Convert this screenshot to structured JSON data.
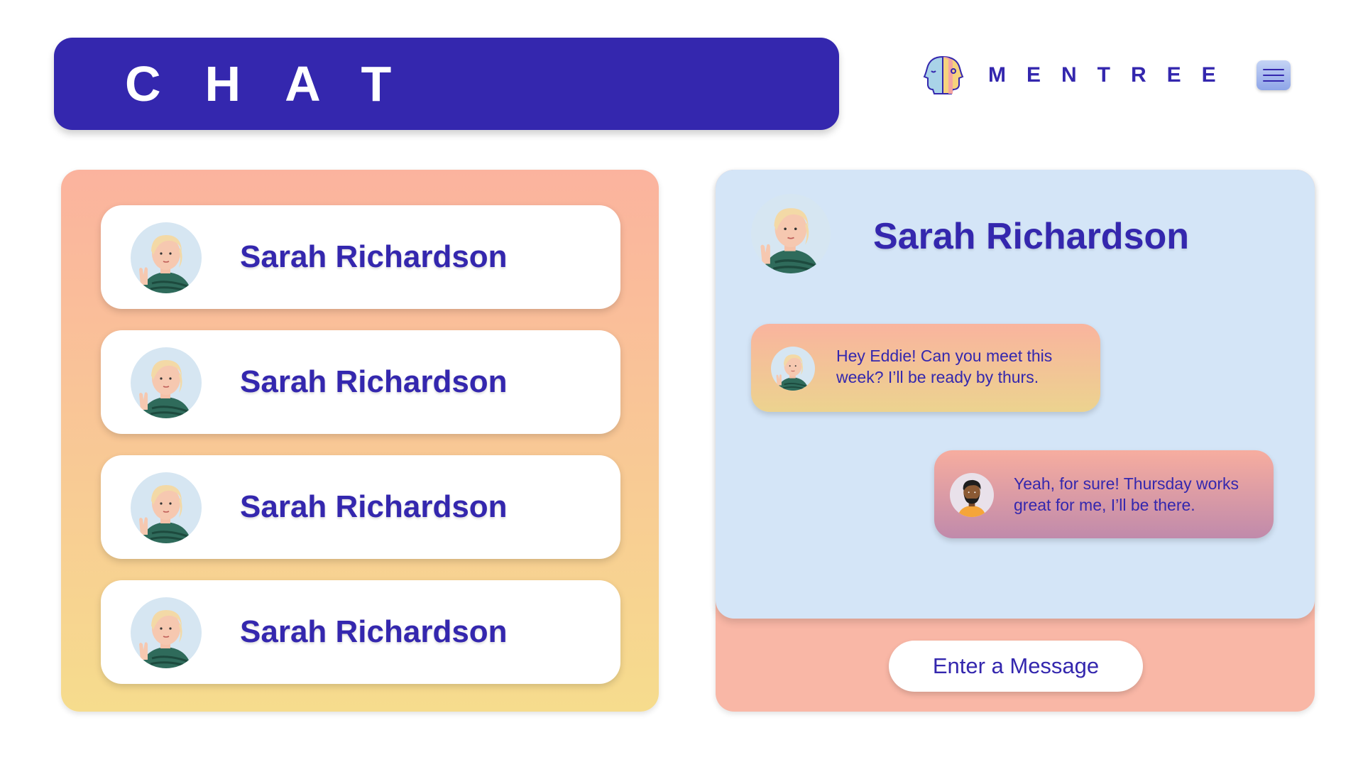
{
  "header": {
    "title": "CHAT"
  },
  "brand": {
    "name": "MENTREE",
    "logo_icon": "two-heads-logo-icon",
    "menu_icon": "hamburger-menu-icon"
  },
  "contacts": [
    {
      "name": "Sarah Richardson",
      "avatar_icon": "sarah-avatar-icon"
    },
    {
      "name": "Sarah Richardson",
      "avatar_icon": "sarah-avatar-icon"
    },
    {
      "name": "Sarah Richardson",
      "avatar_icon": "sarah-avatar-icon"
    },
    {
      "name": "Sarah Richardson",
      "avatar_icon": "sarah-avatar-icon"
    }
  ],
  "conversation": {
    "contact_name": "Sarah Richardson",
    "messages": [
      {
        "from": "contact",
        "avatar_icon": "sarah-avatar-icon",
        "text": "Hey Eddie! Can you meet this week? I’ll be ready by thurs."
      },
      {
        "from": "me",
        "avatar_icon": "eddie-avatar-icon",
        "text": "Yeah, for sure! Thursday works great for me, I’ll be there."
      }
    ],
    "input": {
      "placeholder": "Enter a Message"
    }
  },
  "colors": {
    "primary": "#3427ae",
    "contacts_gradient": [
      "#fbb39e",
      "#f6dc8d"
    ],
    "conversation_bg": "#d4e5f7",
    "conversation_footer": "#f9b7a6"
  }
}
